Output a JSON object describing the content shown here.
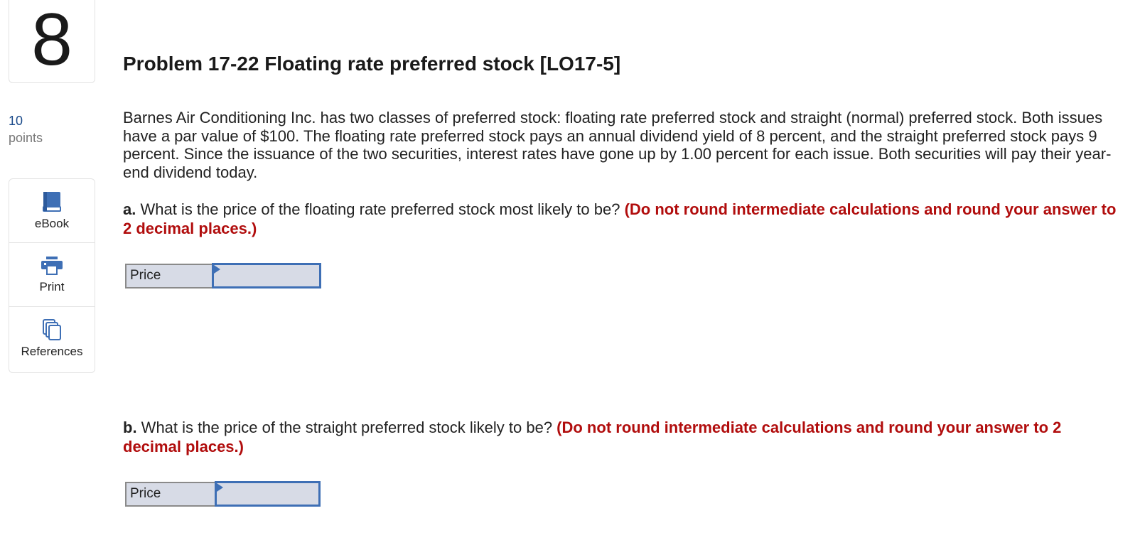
{
  "question": {
    "number": "8",
    "points_value": "10",
    "points_unit": "points",
    "title": "Problem 17-22 Floating rate preferred stock [LO17-5]",
    "body": "Barnes Air Conditioning Inc. has two classes of preferred stock: floating rate preferred stock and straight (normal) preferred stock. Both issues have a par value of $100. The floating rate preferred stock pays an annual dividend yield of 8 percent, and the straight preferred stock pays 9 percent. Since the issuance of the two securities, interest rates have gone up by 1.00 percent for each issue. Both securities will pay their year-end dividend today."
  },
  "tools": [
    {
      "label": "eBook",
      "icon": "book-icon"
    },
    {
      "label": "Print",
      "icon": "printer-icon"
    },
    {
      "label": "References",
      "icon": "references-icon"
    }
  ],
  "parts": [
    {
      "label": "a.",
      "text": " What is the price of the floating rate preferred stock most likely to be? ",
      "note": "(Do not round intermediate calculations and round your answer to 2 decimal places.)",
      "field_label": "Price",
      "field_value": ""
    },
    {
      "label": "b.",
      "text": " What is the price of the straight preferred stock likely to be? ",
      "note": "(Do not round intermediate calculations and round your answer to 2 decimal places.)",
      "field_label": "Price",
      "field_value": ""
    }
  ],
  "colors": {
    "note_red": "#b10d0d",
    "accent_blue": "#3e6fb5",
    "input_bg": "#d7dbe6"
  }
}
